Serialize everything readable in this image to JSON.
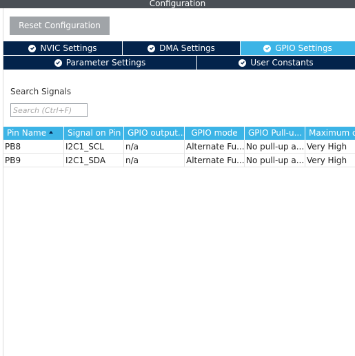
{
  "window": {
    "title": "Configuration"
  },
  "toolbar": {
    "reset_label": "Reset Configuration"
  },
  "tabs_row1": [
    {
      "label": "NVIC Settings",
      "active": false
    },
    {
      "label": "DMA Settings",
      "active": false
    },
    {
      "label": "GPIO Settings",
      "active": true
    }
  ],
  "tabs_row2": [
    {
      "label": "Parameter Settings"
    },
    {
      "label": "User Constants"
    }
  ],
  "search": {
    "label": "Search Signals",
    "placeholder": "Search (Ctrl+F)",
    "value": ""
  },
  "table": {
    "columns": [
      "Pin Name",
      "Signal on Pin",
      "GPIO output...",
      "GPIO mode",
      "GPIO Pull-u...",
      "Maximum o"
    ],
    "rows": [
      [
        "PB8",
        "I2C1_SCL",
        "n/a",
        "Alternate Fu...",
        "No pull-up a...",
        "Very High"
      ],
      [
        "PB9",
        "I2C1_SDA",
        "n/a",
        "Alternate Fu...",
        "No pull-up a...",
        "Very High"
      ]
    ]
  },
  "colors": {
    "tab_dark": "#03234b",
    "tab_active": "#3cb4e6",
    "header": "#3cb4e6",
    "button": "#a0a4a8"
  },
  "icons": {
    "tab_status": "check-circle-icon",
    "sort": "sort-ascending-icon"
  }
}
